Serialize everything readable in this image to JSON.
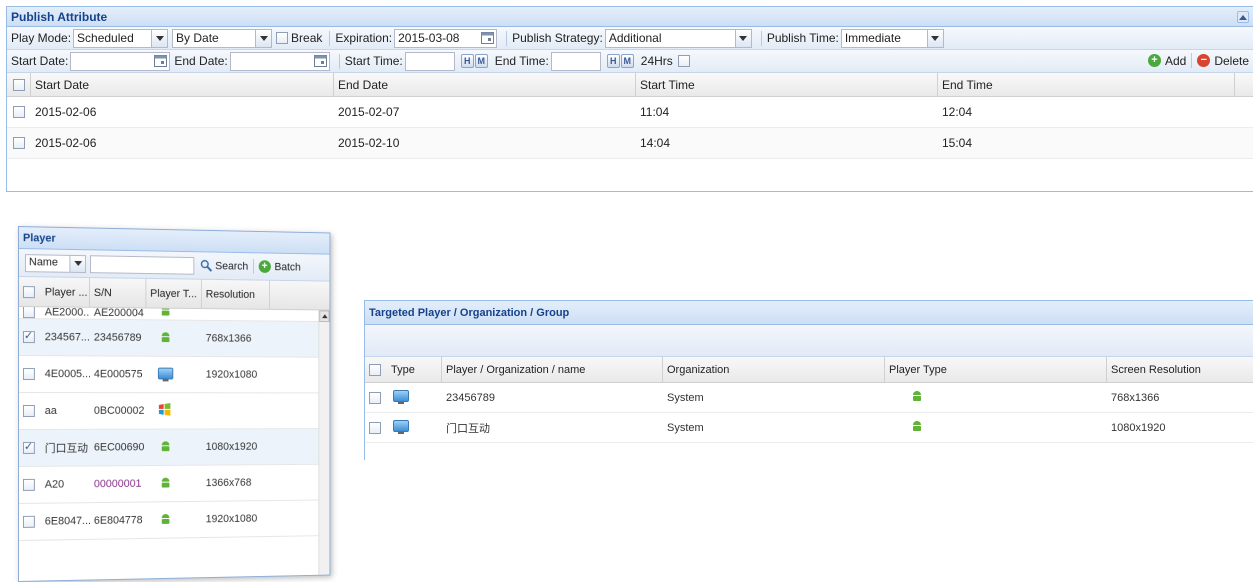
{
  "publish": {
    "title": "Publish Attribute",
    "play_mode_label": "Play Mode:",
    "play_mode_value": "Scheduled",
    "date_mode_value": "By Date",
    "break_label": "Break",
    "expiration_label": "Expiration:",
    "expiration_value": "2015-03-08",
    "strategy_label": "Publish Strategy:",
    "strategy_value": "Additional",
    "time_label": "Publish Time:",
    "time_value": "Immediate",
    "start_date_label": "Start Date:",
    "end_date_label": "End Date:",
    "start_time_label": "Start Time:",
    "end_time_label": "End Time:",
    "hrs24_label": "24Hrs",
    "add_label": "Add",
    "delete_label": "Delete",
    "columns": [
      "Start Date",
      "End Date",
      "Start Time",
      "End Time"
    ],
    "rows": [
      [
        "2015-02-06",
        "2015-02-07",
        "11:04",
        "12:04"
      ],
      [
        "2015-02-06",
        "2015-02-10",
        "14:04",
        "15:04"
      ]
    ]
  },
  "player": {
    "title": "Player",
    "filter_value": "Name",
    "search_label": "Search",
    "batch_label": "Batch",
    "columns": [
      "Player ...",
      "S/N",
      "Player T...",
      "Resolution"
    ],
    "rows": [
      {
        "name": "AE2000...",
        "sn": "AE200004",
        "type": "android",
        "resolution": "",
        "checked": false
      },
      {
        "name": "234567...",
        "sn": "23456789",
        "type": "android",
        "resolution": "768x1366",
        "checked": true
      },
      {
        "name": "4E0005...",
        "sn": "4E000575",
        "type": "pc",
        "resolution": "1920x1080",
        "checked": false
      },
      {
        "name": "aa",
        "sn": "0BC00002",
        "type": "windows",
        "resolution": "",
        "checked": false
      },
      {
        "name": "门口互动",
        "sn": "6EC00690",
        "type": "android",
        "resolution": "1080x1920",
        "checked": true
      },
      {
        "name": "A20",
        "sn": "00000001",
        "type": "android",
        "resolution": "1366x768",
        "checked": false
      },
      {
        "name": "6E8047...",
        "sn": "6E804778",
        "type": "android",
        "resolution": "1920x1080",
        "checked": false
      }
    ]
  },
  "targeted": {
    "title": "Targeted Player / Organization / Group",
    "columns": [
      "Type",
      "Player / Organization / name",
      "Organization",
      "Player Type",
      "Screen Resolution"
    ],
    "rows": [
      {
        "name": "23456789",
        "organization": "System",
        "resolution": "768x1366"
      },
      {
        "name": "门口互动",
        "organization": "System",
        "resolution": "1080x1920"
      }
    ]
  },
  "colors": {
    "header_blue": "#15428b",
    "border_blue": "#99bbe8",
    "add_green": "#4aa83c",
    "delete_red": "#d9432f",
    "android_green": "#5fb336"
  }
}
